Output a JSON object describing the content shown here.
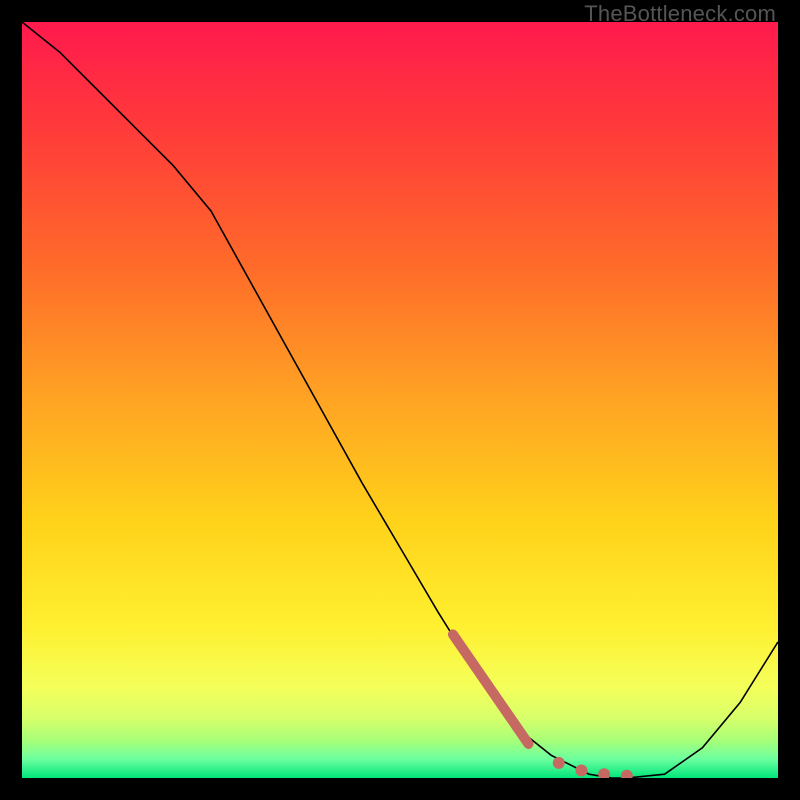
{
  "watermark": "TheBottleneck.com",
  "chart_data": {
    "type": "line",
    "title": "",
    "xlabel": "",
    "ylabel": "",
    "xlim": [
      0,
      100
    ],
    "ylim": [
      0,
      100
    ],
    "grid": false,
    "legend": false,
    "background_gradient": {
      "top_color": "#ff1a4d",
      "mid_color": "#ffd400",
      "bottom_band_colors": [
        "#e9ff7a",
        "#b5ff7a",
        "#7aff9a",
        "#00e67a"
      ]
    },
    "series": [
      {
        "name": "bottleneck-curve",
        "color": "#000000",
        "style": "solid",
        "x": [
          0,
          5,
          10,
          15,
          20,
          25,
          30,
          35,
          40,
          45,
          50,
          55,
          60,
          65,
          70,
          75,
          78,
          80,
          85,
          90,
          95,
          100
        ],
        "y": [
          100,
          96,
          91,
          86,
          81,
          75,
          66,
          57,
          48,
          39,
          30.5,
          22,
          14,
          7,
          3,
          0.5,
          0,
          0,
          0.5,
          4,
          10,
          18
        ]
      },
      {
        "name": "highlight-dash",
        "color": "#c56962",
        "style": "thick-dashed",
        "x": [
          57,
          67,
          71,
          74,
          77,
          80
        ],
        "y": [
          19,
          4.5,
          2,
          1,
          0.5,
          0.3
        ]
      }
    ]
  }
}
